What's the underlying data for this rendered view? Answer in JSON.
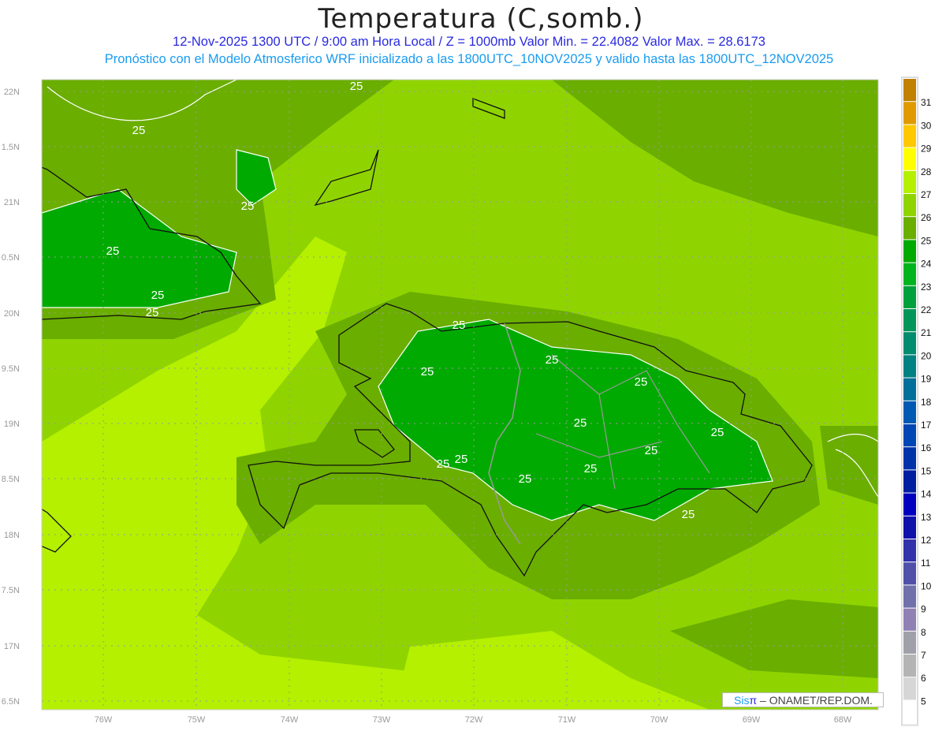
{
  "header": {
    "title": "Temperatura (C,somb.)",
    "subtitle1": "12-Nov-2025  1300 UTC / 9:00 am Hora Local / Z = 1000mb    Valor Min. = 22.4082  Valor Max. = 28.6173",
    "subtitle2": "Pronóstico con el Modelo Atmosferico WRF inicializado a las 1800UTC_10NOV2025 y valido hasta las  1800UTC_12NOV2025"
  },
  "map": {
    "lon_ticks": [
      "76W",
      "75W",
      "74W",
      "73W",
      "72W",
      "71W",
      "70W",
      "69W",
      "68W"
    ],
    "lat_ticks": [
      "22N",
      "1.5N",
      "21N",
      "0.5N",
      "20N",
      "9.5N",
      "19N",
      "8.5N",
      "18N",
      "7.5N",
      "17N",
      "6.5N"
    ],
    "contour_labels": [
      "25",
      "25",
      "25",
      "25",
      "25",
      "25",
      "25",
      "25",
      "25",
      "25",
      "25",
      "25",
      "25",
      "25",
      "25",
      "25",
      "25",
      "25"
    ],
    "colors": {
      "t24": "#00aa00",
      "t25": "#6aae00",
      "t26": "#8fd400",
      "t27": "#b4f000",
      "coast": "#111111",
      "border": "#999999"
    }
  },
  "colorbar": {
    "levels": [
      "31",
      "30",
      "29",
      "28",
      "27",
      "26",
      "25",
      "24",
      "23",
      "22",
      "21",
      "20",
      "19",
      "18",
      "17",
      "16",
      "15",
      "14",
      "13",
      "12",
      "11",
      "10",
      "9",
      "8",
      "7",
      "6",
      "5"
    ],
    "colors": [
      "#c08000",
      "#e09a00",
      "#ffc800",
      "#ffff00",
      "#b4f000",
      "#8fd400",
      "#6aae00",
      "#00aa00",
      "#00b41e",
      "#00a03c",
      "#00965a",
      "#008c6e",
      "#008282",
      "#00709a",
      "#005ab4",
      "#0046b4",
      "#0032aa",
      "#001ea0",
      "#0000be",
      "#1010aa",
      "#3232aa",
      "#5050aa",
      "#7070aa",
      "#9080b4",
      "#a0a0aa",
      "#b4b4b4",
      "#d6d6d6",
      "#ffffff"
    ]
  },
  "credit": {
    "sis": "Sis",
    "pi": "π",
    "rest": " –  ONAMET/REP.DOM."
  }
}
